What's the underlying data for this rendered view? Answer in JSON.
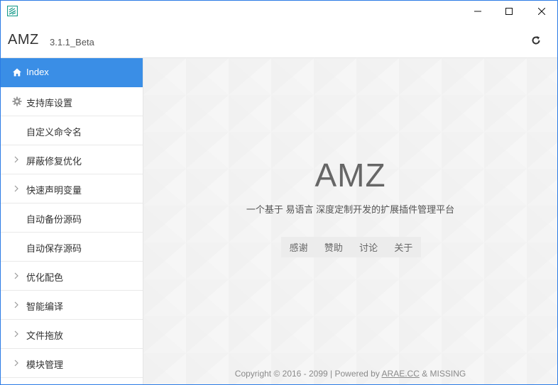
{
  "window": {
    "controls": [
      "minimize-icon",
      "maximize-icon",
      "close-icon"
    ],
    "border_color": "#2b7be5"
  },
  "header": {
    "brand": "AMZ",
    "version": "3.1.1_Beta",
    "refresh_icon": "refresh-icon"
  },
  "sidebar": {
    "items": [
      {
        "label": "Index",
        "icon": "home-icon",
        "active": true
      },
      {
        "label": "支持库设置",
        "icon": "gear-icon"
      },
      {
        "label": "自定义命令名"
      },
      {
        "label": "屏蔽修复优化",
        "icon": "chevron-right-icon"
      },
      {
        "label": "快速声明变量",
        "icon": "chevron-right-icon"
      },
      {
        "label": "自动备份源码"
      },
      {
        "label": "自动保存源码"
      },
      {
        "label": "优化配色",
        "icon": "chevron-right-icon"
      },
      {
        "label": "智能编译",
        "icon": "chevron-right-icon"
      },
      {
        "label": "文件拖放",
        "icon": "chevron-right-icon"
      },
      {
        "label": "模块管理",
        "icon": "chevron-right-icon"
      }
    ],
    "active_color": "#3a8ee6"
  },
  "main": {
    "title": "AMZ",
    "subtitle": "一个基于 易语言 深度定制开发的扩展插件管理平台",
    "links": [
      "感谢",
      "赞助",
      "讨论",
      "关于"
    ],
    "footer": {
      "prefix": "Copyright © 2016 - 2099  |  Powered by ",
      "link": "ARAE.CC",
      "suffix": " & MISSING"
    }
  }
}
